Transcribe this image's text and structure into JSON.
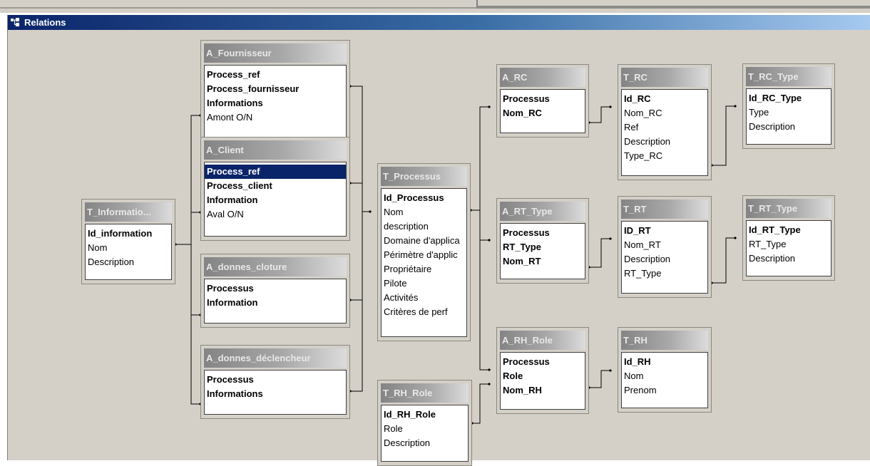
{
  "window": {
    "title": "Relations"
  },
  "tables": {
    "t_information": {
      "name": "T_Informatio...",
      "fields": [
        {
          "label": "Id_information",
          "key": true
        },
        {
          "label": "Nom",
          "key": false
        },
        {
          "label": "Description",
          "key": false
        }
      ]
    },
    "a_fournisseur": {
      "name": "A_Fournisseur",
      "fields": [
        {
          "label": "Process_ref",
          "key": true
        },
        {
          "label": "Process_fournisseur",
          "key": true
        },
        {
          "label": "Informations",
          "key": true
        },
        {
          "label": "Amont O/N",
          "key": false
        }
      ]
    },
    "a_client": {
      "name": "A_Client",
      "fields": [
        {
          "label": "Process_ref",
          "key": true,
          "selected": true
        },
        {
          "label": "Process_client",
          "key": true
        },
        {
          "label": "Information",
          "key": true
        },
        {
          "label": "Aval O/N",
          "key": false
        }
      ]
    },
    "a_donnes_cloture": {
      "name": "A_donnes_cloture",
      "fields": [
        {
          "label": "Processus",
          "key": true
        },
        {
          "label": "Information",
          "key": true
        }
      ]
    },
    "a_donnes_declencheur": {
      "name": "A_donnes_déclencheur",
      "fields": [
        {
          "label": "Processus",
          "key": true
        },
        {
          "label": "Informations",
          "key": true
        }
      ]
    },
    "t_processus": {
      "name": "T_Processus",
      "fields": [
        {
          "label": "Id_Processus",
          "key": true
        },
        {
          "label": "Nom",
          "key": false
        },
        {
          "label": "description",
          "key": false
        },
        {
          "label": "Domaine d'applica",
          "key": false
        },
        {
          "label": "Périmètre d'applic",
          "key": false
        },
        {
          "label": "Propriétaire",
          "key": false
        },
        {
          "label": "Pilote",
          "key": false
        },
        {
          "label": "Activités",
          "key": false
        },
        {
          "label": "Critères de perf",
          "key": false
        }
      ]
    },
    "a_rc": {
      "name": "A_RC",
      "fields": [
        {
          "label": "Processus",
          "key": true
        },
        {
          "label": "Nom_RC",
          "key": true
        }
      ]
    },
    "t_rc": {
      "name": "T_RC",
      "fields": [
        {
          "label": "Id_RC",
          "key": true
        },
        {
          "label": "Nom_RC",
          "key": false
        },
        {
          "label": "Ref",
          "key": false
        },
        {
          "label": "Description",
          "key": false
        },
        {
          "label": "Type_RC",
          "key": false
        }
      ]
    },
    "t_rc_type": {
      "name": "T_RC_Type",
      "fields": [
        {
          "label": "Id_RC_Type",
          "key": true
        },
        {
          "label": "Type",
          "key": false
        },
        {
          "label": "Description",
          "key": false
        }
      ]
    },
    "a_rt_type": {
      "name": "A_RT_Type",
      "fields": [
        {
          "label": "Processus",
          "key": true
        },
        {
          "label": "RT_Type",
          "key": true
        },
        {
          "label": "Nom_RT",
          "key": true
        }
      ]
    },
    "t_rt": {
      "name": "T_RT",
      "fields": [
        {
          "label": "ID_RT",
          "key": true
        },
        {
          "label": "Nom_RT",
          "key": false
        },
        {
          "label": "Description",
          "key": false
        },
        {
          "label": "RT_Type",
          "key": false
        }
      ]
    },
    "t_rt_type": {
      "name": "T_RT_Type",
      "fields": [
        {
          "label": "Id_RT_Type",
          "key": true
        },
        {
          "label": "RT_Type",
          "key": false
        },
        {
          "label": "Description",
          "key": false
        }
      ]
    },
    "a_rh_role": {
      "name": "A_RH_Role",
      "fields": [
        {
          "label": "Processus",
          "key": true
        },
        {
          "label": "Role",
          "key": true
        },
        {
          "label": "Nom_RH",
          "key": true
        }
      ]
    },
    "t_rh": {
      "name": "T_RH",
      "fields": [
        {
          "label": "Id_RH",
          "key": true
        },
        {
          "label": "Nom",
          "key": false
        },
        {
          "label": "Prenom",
          "key": false
        }
      ]
    },
    "t_rh_role": {
      "name": "T_RH_Role",
      "fields": [
        {
          "label": "Id_RH_Role",
          "key": true
        },
        {
          "label": "Role",
          "key": false
        },
        {
          "label": "Description",
          "key": false
        }
      ]
    }
  }
}
